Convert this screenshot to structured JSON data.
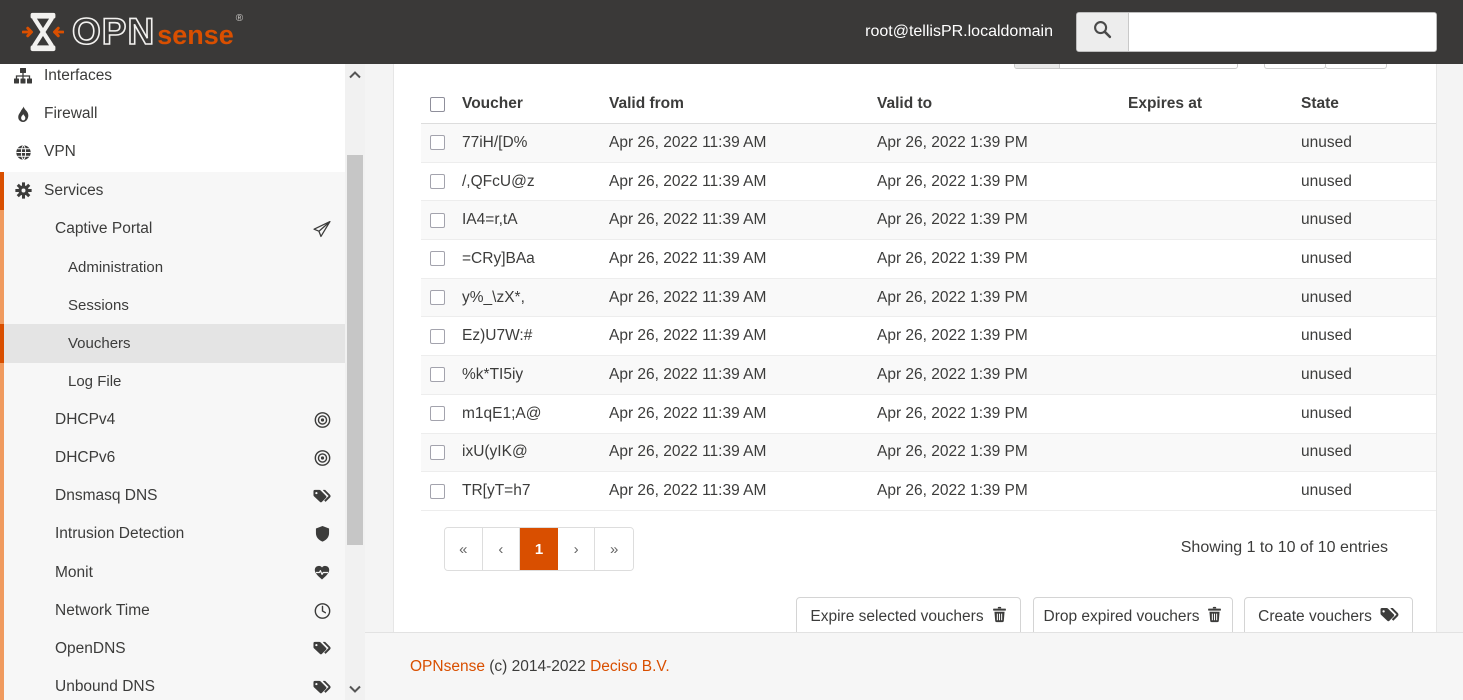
{
  "colors": {
    "accent": "#d94f00",
    "header_bg": "#3a3938",
    "section_border": "#f09a5e",
    "selected_bg": "#e4e4e4"
  },
  "header": {
    "brand": {
      "opn": "OPN",
      "sense": "sense",
      "registered": "®"
    },
    "user": "root@tellisPR.localdomain",
    "search": {
      "placeholder": "",
      "value": "",
      "icon": "search-icon"
    }
  },
  "sidebar": {
    "items": [
      {
        "label": "Interfaces",
        "icon": "sitemap-icon",
        "level": 1
      },
      {
        "label": "Firewall",
        "icon": "fire-icon",
        "level": 1
      },
      {
        "label": "VPN",
        "icon": "globe-icon",
        "level": 1
      },
      {
        "label": "Services",
        "icon": "gear-icon",
        "level": 1,
        "active": true
      },
      {
        "label": "Captive Portal",
        "level": 2,
        "right_icon": "paper-plane-icon"
      },
      {
        "label": "Administration",
        "level": 3
      },
      {
        "label": "Sessions",
        "level": 3
      },
      {
        "label": "Vouchers",
        "level": 3,
        "selected": true
      },
      {
        "label": "Log File",
        "level": 3
      },
      {
        "label": "DHCPv4",
        "level": 2,
        "right_icon": "bullseye-icon"
      },
      {
        "label": "DHCPv6",
        "level": 2,
        "right_icon": "bullseye-icon"
      },
      {
        "label": "Dnsmasq DNS",
        "level": 2,
        "right_icon": "tags-icon"
      },
      {
        "label": "Intrusion Detection",
        "level": 2,
        "right_icon": "shield-icon"
      },
      {
        "label": "Monit",
        "level": 2,
        "right_icon": "heartbeat-icon"
      },
      {
        "label": "Network Time",
        "level": 2,
        "right_icon": "clock-icon"
      },
      {
        "label": "OpenDNS",
        "level": 2,
        "right_icon": "tags-icon"
      },
      {
        "label": "Unbound DNS",
        "level": 2,
        "right_icon": "tags-icon"
      }
    ]
  },
  "table": {
    "columns": [
      "Voucher",
      "Valid from",
      "Valid to",
      "Expires at",
      "State"
    ],
    "rows": [
      {
        "voucher": "77iH/[D%",
        "from": "Apr 26, 2022 11:39 AM",
        "to": "Apr 26, 2022 1:39 PM",
        "expires": "",
        "state": "unused"
      },
      {
        "voucher": "/,QFcU@z",
        "from": "Apr 26, 2022 11:39 AM",
        "to": "Apr 26, 2022 1:39 PM",
        "expires": "",
        "state": "unused"
      },
      {
        "voucher": "IA4=r,tA",
        "from": "Apr 26, 2022 11:39 AM",
        "to": "Apr 26, 2022 1:39 PM",
        "expires": "",
        "state": "unused"
      },
      {
        "voucher": "=CRy]BAa",
        "from": "Apr 26, 2022 11:39 AM",
        "to": "Apr 26, 2022 1:39 PM",
        "expires": "",
        "state": "unused"
      },
      {
        "voucher": "y%_\\zX*,",
        "from": "Apr 26, 2022 11:39 AM",
        "to": "Apr 26, 2022 1:39 PM",
        "expires": "",
        "state": "unused"
      },
      {
        "voucher": "Ez)U7W:#",
        "from": "Apr 26, 2022 11:39 AM",
        "to": "Apr 26, 2022 1:39 PM",
        "expires": "",
        "state": "unused"
      },
      {
        "voucher": "%k*TI5iy",
        "from": "Apr 26, 2022 11:39 AM",
        "to": "Apr 26, 2022 1:39 PM",
        "expires": "",
        "state": "unused"
      },
      {
        "voucher": "m1qE1;A@",
        "from": "Apr 26, 2022 11:39 AM",
        "to": "Apr 26, 2022 1:39 PM",
        "expires": "",
        "state": "unused"
      },
      {
        "voucher": "ixU(yIK@",
        "from": "Apr 26, 2022 11:39 AM",
        "to": "Apr 26, 2022 1:39 PM",
        "expires": "",
        "state": "unused"
      },
      {
        "voucher": "TR[yT=h7",
        "from": "Apr 26, 2022 11:39 AM",
        "to": "Apr 26, 2022 1:39 PM",
        "expires": "",
        "state": "unused"
      }
    ]
  },
  "pagination": {
    "first": "«",
    "prev": "‹",
    "page": "1",
    "next": "›",
    "last": "»"
  },
  "summary": "Showing 1 to 10 of 10 entries",
  "actions": {
    "expire": {
      "label": "Expire selected vouchers",
      "icon": "trash-icon"
    },
    "drop": {
      "label": "Drop expired vouchers",
      "icon": "trash-icon"
    },
    "create": {
      "label": "Create vouchers",
      "icon": "tags-icon"
    }
  },
  "footer": {
    "brand": "OPNsense",
    "copyright": "(c) 2014-2022",
    "company": "Deciso B.V."
  }
}
